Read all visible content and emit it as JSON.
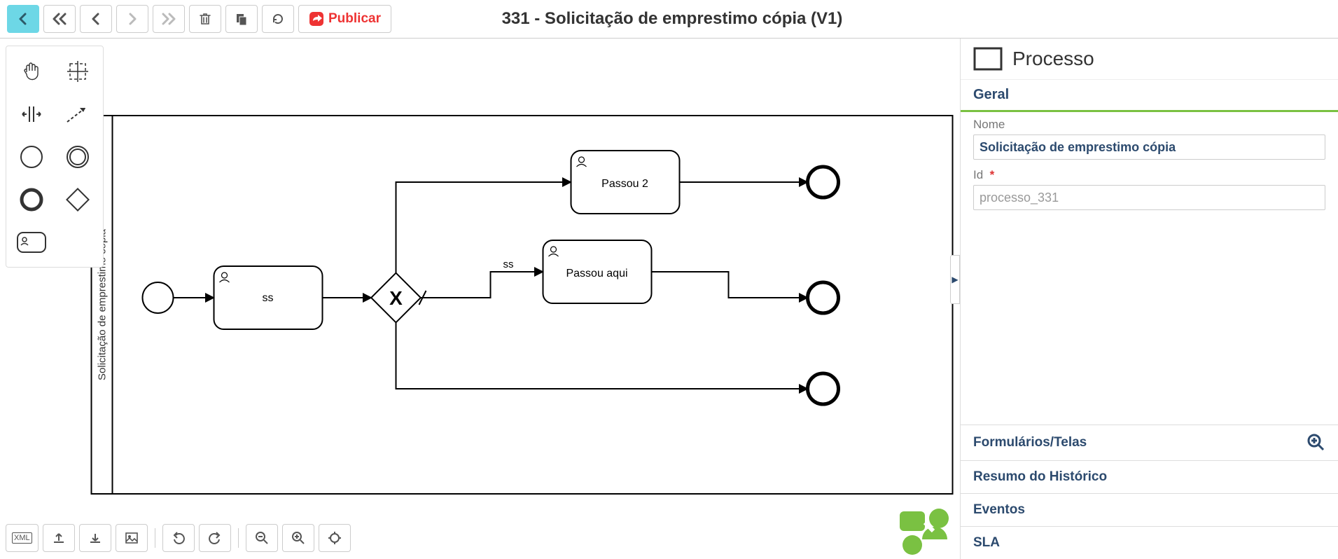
{
  "header": {
    "title": "331 - Solicitação de emprestimo cópia (V1)",
    "publish_label": "Publicar"
  },
  "panel": {
    "type_label": "Processo",
    "section_general": "Geral",
    "name_label": "Nome",
    "name_value": "Solicitação de emprestimo cópia",
    "id_label": "Id",
    "id_value": "processo_331",
    "sections": {
      "forms": "Formulários/Telas",
      "history": "Resumo do Histórico",
      "events": "Eventos",
      "sla": "SLA"
    }
  },
  "diagram": {
    "lane_label": "Solicitação de emprestimo cópia",
    "task_ss": "ss",
    "gateway_edge_label": "ss",
    "task_passou2": "Passou 2",
    "task_passou_aqui": "Passou aqui"
  }
}
